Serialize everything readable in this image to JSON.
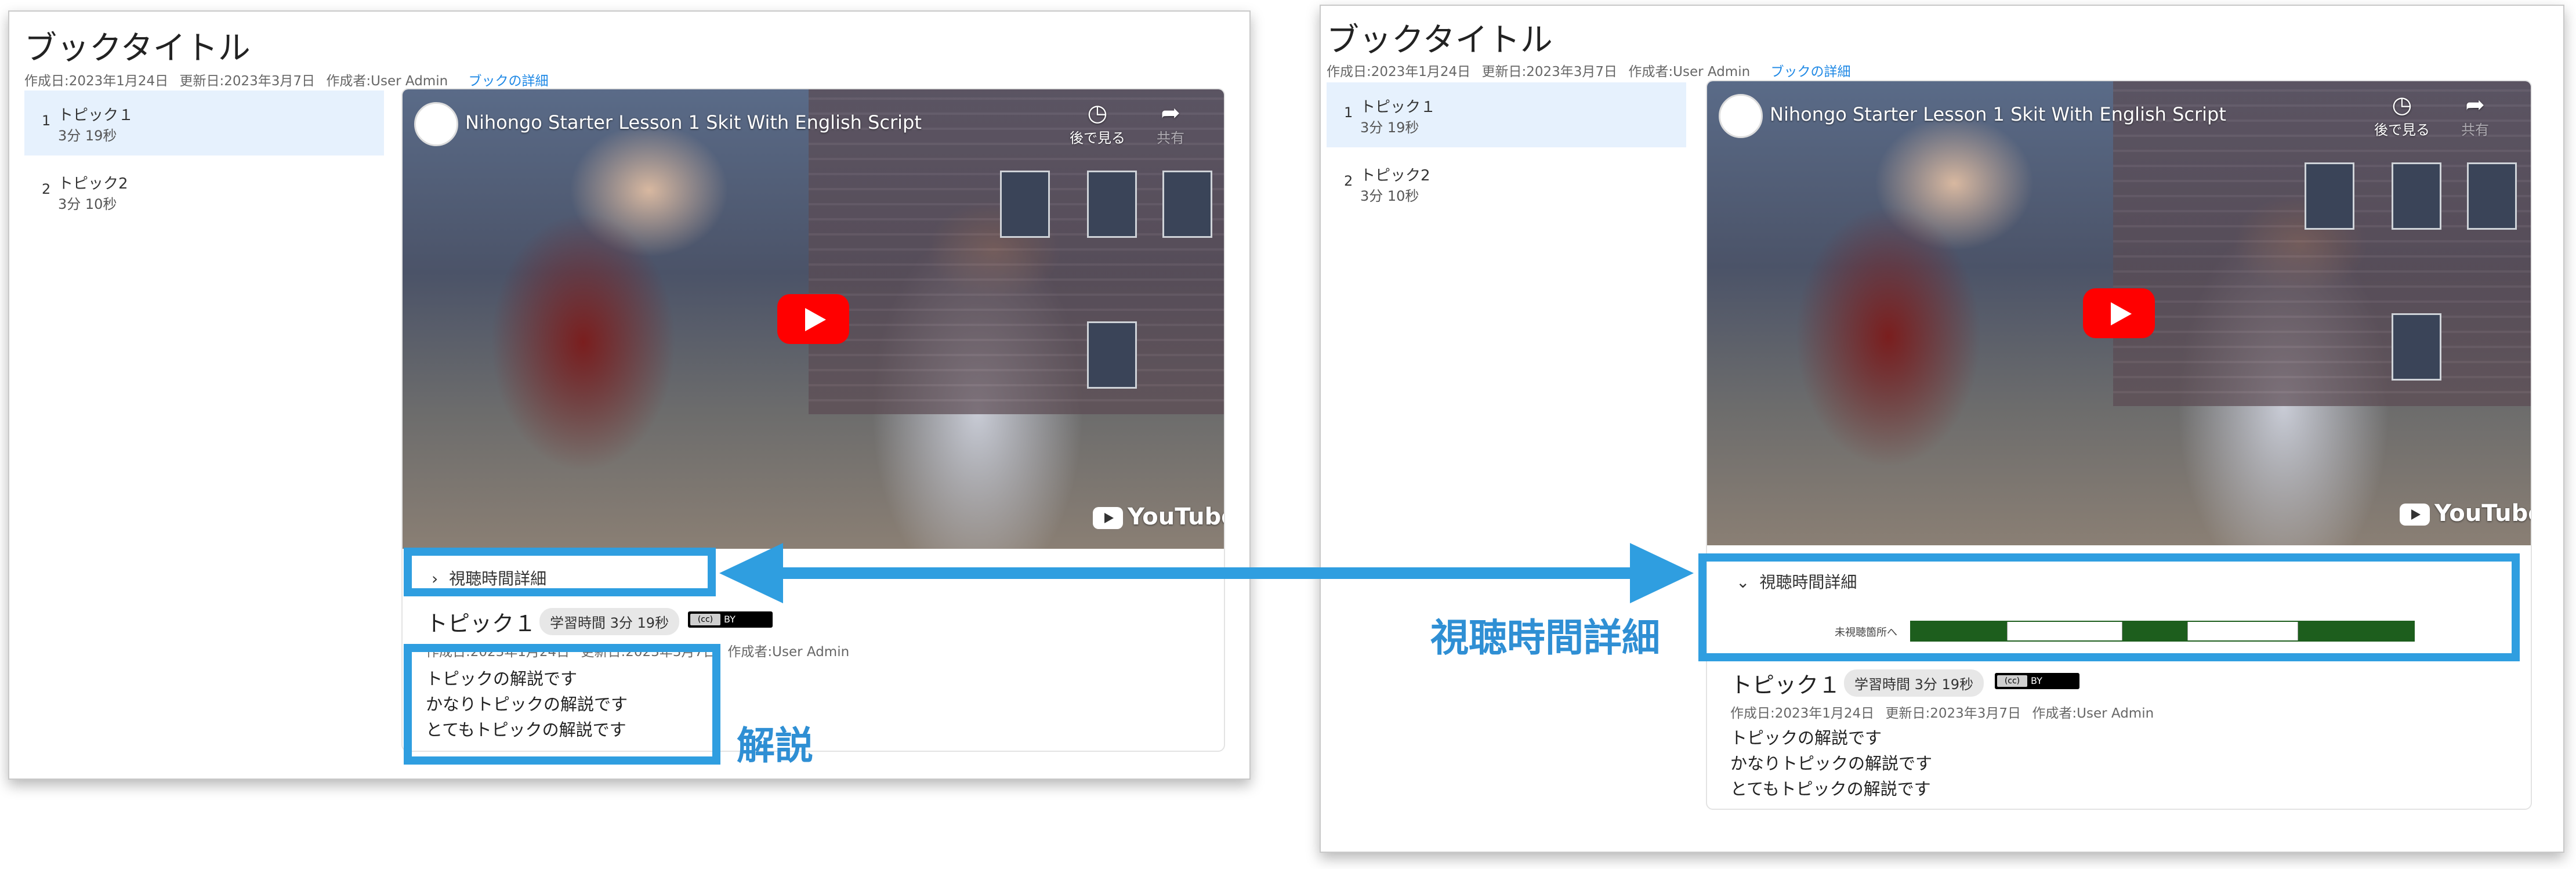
{
  "book": {
    "title": "ブックタイトル",
    "created": "作成日:2023年1月24日",
    "updated": "更新日:2023年3月7日",
    "author": "作成者:User Admin",
    "detail_link": "ブックの詳細"
  },
  "sidebar": {
    "items": [
      {
        "num": "1",
        "name": "トピック１",
        "duration": "3分 19秒",
        "active": true
      },
      {
        "num": "2",
        "name": "トピック2",
        "duration": "3分 10秒",
        "active": false
      }
    ]
  },
  "video": {
    "title": "Nihongo Starter Lesson 1 Skit With English Script",
    "watch_later": "後で見る",
    "share": "共有",
    "logo": "YouTube"
  },
  "watch_detail": {
    "label": "視聴時間詳細",
    "unwatched_label": "未視聴箇所へ",
    "segments": [
      {
        "state": "watched",
        "fraction": 0.19
      },
      {
        "state": "unwatched",
        "fraction": 0.23
      },
      {
        "state": "watched",
        "fraction": 0.13
      },
      {
        "state": "unwatched",
        "fraction": 0.22
      },
      {
        "state": "watched",
        "fraction": 0.23
      }
    ],
    "colors": {
      "watched": "#1d5e1d",
      "unwatched": "#ffffff"
    }
  },
  "topic": {
    "title": "トピック１",
    "study_time": "学習時間 3分 19秒",
    "license": "BY",
    "created": "作成日:2023年1月24日",
    "updated": "更新日:2023年3月7日",
    "author": "作成者:User Admin",
    "description": [
      "トピックの解説です",
      "かなりトピックの解説です",
      "とてもトピックの解説です"
    ]
  },
  "annotations": {
    "explanation": "解説",
    "watch_detail": "視聴時間詳細",
    "accent_color": "#2f9ee0"
  }
}
